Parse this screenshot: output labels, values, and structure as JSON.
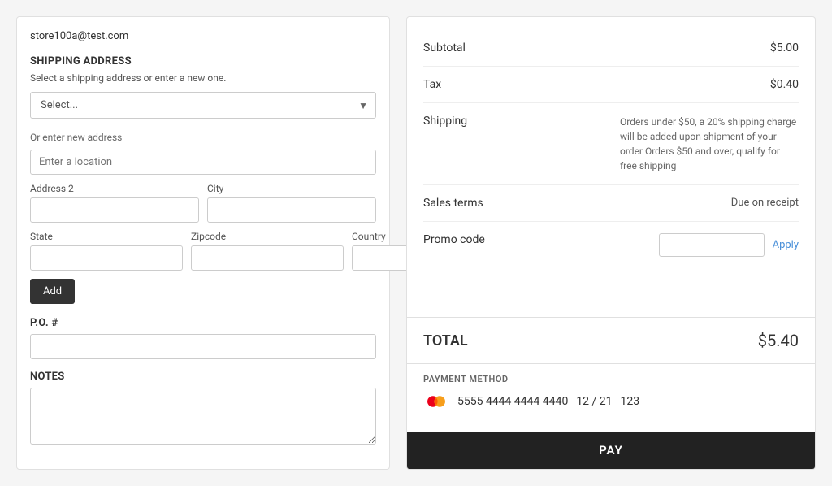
{
  "user": {
    "email": "store100a@test.com"
  },
  "shipping": {
    "section_title": "SHIPPING ADDRESS",
    "subtitle": "Select a shipping address or enter a new one.",
    "select_placeholder": "Select...",
    "or_enter_label": "Or enter new address",
    "location_placeholder": "Enter a location",
    "address2_label": "Address 2",
    "city_label": "City",
    "state_label": "State",
    "zipcode_label": "Zipcode",
    "country_label": "Country",
    "add_button": "Add"
  },
  "po": {
    "label": "P.O. #"
  },
  "notes": {
    "label": "NOTES"
  },
  "summary": {
    "subtotal_label": "Subtotal",
    "subtotal_value": "$5.00",
    "tax_label": "Tax",
    "tax_value": "$0.40",
    "shipping_label": "Shipping",
    "shipping_description": "Orders under $50, a 20% shipping charge will be added upon shipment of your order Orders $50 and over, qualify for free shipping",
    "sales_terms_label": "Sales terms",
    "sales_terms_value": "Due on receipt",
    "promo_code_label": "Promo code",
    "apply_button": "Apply"
  },
  "total": {
    "label": "TOTAL",
    "value": "$5.40"
  },
  "payment": {
    "title": "PAYMENT METHOD",
    "card_number": "5555 4444 4444 4440",
    "card_expiry": "12 / 21",
    "card_cvv": "123",
    "pay_button": "PAY"
  }
}
